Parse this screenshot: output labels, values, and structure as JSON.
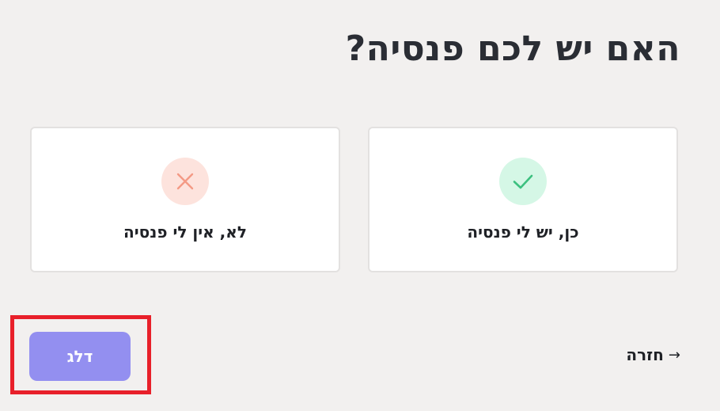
{
  "question": {
    "title": "האם יש לכם פנסיה?"
  },
  "options": [
    {
      "label": "כן, יש לי פנסיה",
      "icon": "check-icon",
      "icon_color": "#3cc07f",
      "icon_bg": "#d5f7e6"
    },
    {
      "label": "לא, אין לי פנסיה",
      "icon": "x-icon",
      "icon_color": "#f49a85",
      "icon_bg": "#fde3dd"
    }
  ],
  "footer": {
    "back_label": "חזרה",
    "back_icon": "arrow-right-icon",
    "skip_label": "דלג",
    "skip_color": "#938ff0",
    "highlight_color": "#e8202a"
  }
}
